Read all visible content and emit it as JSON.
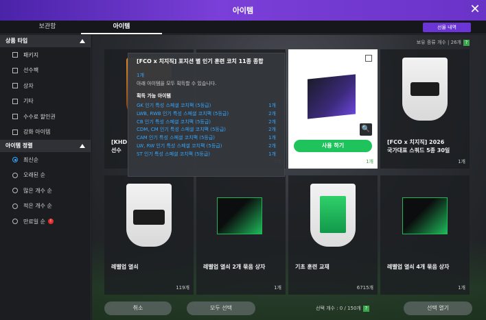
{
  "window": {
    "title": "아이템"
  },
  "tabs": [
    {
      "label": "보관함"
    },
    {
      "label": "아이템"
    }
  ],
  "gift_button": "선물 내역",
  "sidebar": {
    "type_header": "상품 타입",
    "types": [
      "패키지",
      "선수팩",
      "상자",
      "기타",
      "수수료 할인권",
      "강화 아이템"
    ],
    "sort_header": "아이템 정렬",
    "sorts": [
      "최신순",
      "오래된 순",
      "많은 개수 순",
      "적은 개수 순",
      "만료일 순"
    ],
    "sort_badge": "!"
  },
  "main": {
    "count_label": "보유 종류 개수",
    "count_value": "26개",
    "help": "?"
  },
  "cards": [
    {
      "name": "[KHD",
      "name2": "선수",
      "count": ""
    },
    {
      "name": "",
      "count": "1개"
    },
    {
      "name": "[FCO x 치지직] 2026",
      "name2": "국가대표 스쿼드 5종 30일",
      "count": "1개"
    },
    {
      "name": "레벨업 열쇠",
      "count": "119개"
    },
    {
      "name": "레벨업 열쇠 2개 묶음 상자",
      "count": "1개"
    },
    {
      "name": "기초 훈련 교재",
      "count": "6715개"
    },
    {
      "name": "레벨업 열쇠 4개 묶음 상자",
      "count": "1개"
    }
  ],
  "use_button": "사용 하기",
  "tooltip": {
    "title": "[FCO x 치지직] 포지션 별 인기 훈련 코치 11종 종합",
    "qty": "1개",
    "desc": "아래 아이템을 모두 획득할 수 있습니다.",
    "head": "획득 가능 아이템",
    "rows": [
      {
        "name": "GK 인기 특성 스페셜 코치팩 (5등급)",
        "qty": "1개"
      },
      {
        "name": "LWB, RWB 인기 특성 스페셜 코치팩 (5등급)",
        "qty": "2개"
      },
      {
        "name": "CB 인기 특성 스페셜 코치팩 (5등급)",
        "qty": "2개"
      },
      {
        "name": "CDM, CM 인기 특성 스페셜 코치팩 (5등급)",
        "qty": "2개"
      },
      {
        "name": "CAM 인기 특성 스페셜 코치팩 (5등급)",
        "qty": "1개"
      },
      {
        "name": "LW, RW 인기 특성 스페셜 코치팩 (5등급)",
        "qty": "2개"
      },
      {
        "name": "ST 인기 특성 스페셜 코치팩 (5등급)",
        "qty": "1개"
      }
    ]
  },
  "bottom": {
    "cancel": "취소",
    "select_all": "모두 선택",
    "selected_label": "선택 개수 : 0 / 150개",
    "open": "선택 열기"
  }
}
